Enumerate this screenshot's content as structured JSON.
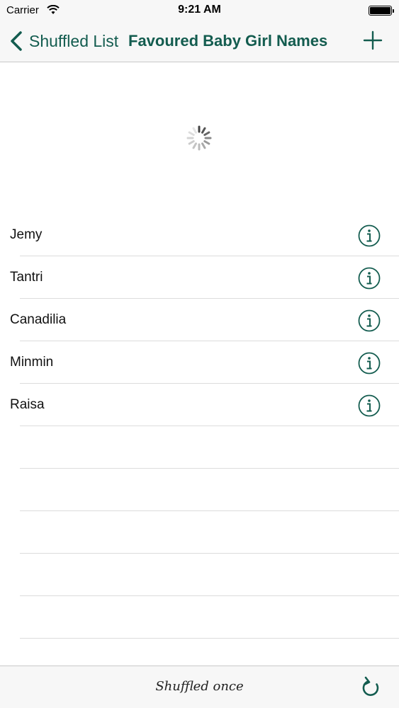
{
  "status_bar": {
    "carrier": "Carrier",
    "time": "9:21 AM",
    "wifi_icon": "wifi-icon",
    "battery_icon": "battery-icon"
  },
  "nav": {
    "back_label": "Shuffled List",
    "title": "Favoured Baby Girl Names",
    "add_icon": "plus-icon"
  },
  "list": {
    "items": [
      {
        "label": "Jemy"
      },
      {
        "label": "Tantri"
      },
      {
        "label": "Canadilia"
      },
      {
        "label": "Minmin"
      },
      {
        "label": "Raisa"
      }
    ],
    "empty_rows": 6
  },
  "toolbar": {
    "status": "Shuffled once",
    "refresh_icon": "refresh-icon"
  },
  "colors": {
    "accent": "#135c4f",
    "bar_background": "#f7f7f7",
    "separator": "#dcdcdc"
  }
}
